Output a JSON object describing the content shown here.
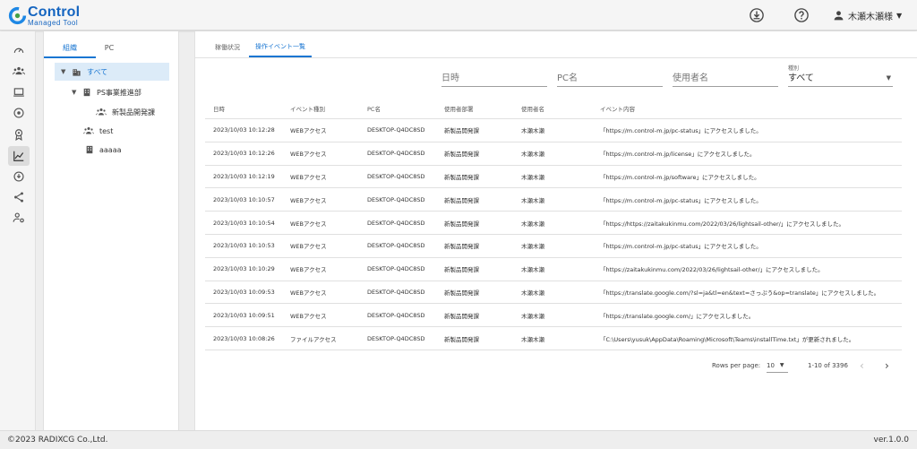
{
  "header": {
    "logo_text": "Control",
    "logo_sub": "Managed Tool",
    "user_name": "木瀬木瀬様",
    "icons": [
      "download-icon",
      "help-icon",
      "account-icon",
      "chevron-down-icon"
    ]
  },
  "rail": {
    "items": [
      {
        "icon": "dashboard-icon",
        "active": false
      },
      {
        "icon": "group-icon",
        "active": false
      },
      {
        "icon": "laptop-icon",
        "active": false
      },
      {
        "icon": "disc-icon",
        "active": false
      },
      {
        "icon": "badge-icon",
        "active": false
      },
      {
        "icon": "chart-icon",
        "active": true
      },
      {
        "icon": "update-icon",
        "active": false
      },
      {
        "icon": "share-icon",
        "active": false
      },
      {
        "icon": "user-settings-icon",
        "active": false
      }
    ]
  },
  "tree": {
    "tabs": [
      "組織",
      "PC"
    ],
    "nodes": [
      {
        "label": "すべて",
        "icon": "building-icon",
        "expanded": true,
        "selected": true
      },
      {
        "label": "PS事業推進部",
        "icon": "building-icon",
        "expanded": true,
        "selected": false
      },
      {
        "label": "新製品開発課",
        "icon": "people-icon",
        "selected": false
      },
      {
        "label": "test",
        "icon": "people-icon",
        "selected": false
      },
      {
        "label": "aaaaa",
        "icon": "building-icon",
        "selected": false
      }
    ]
  },
  "main": {
    "tabs": [
      "稼働状況",
      "操作イベント一覧"
    ],
    "filters": {
      "datetime_placeholder": "日時",
      "pc_placeholder": "PC名",
      "user_placeholder": "使用者名",
      "type_label": "種別",
      "type_value": "すべて"
    },
    "columns": [
      "日時",
      "イベント種別",
      "PC名",
      "使用者部署",
      "使用者名",
      "イベント内容"
    ],
    "rows": [
      [
        "2023/10/03 10:12:28",
        "WEBアクセス",
        "DESKTOP-Q4DC8SD",
        "新製品開発課",
        "木瀬木瀬",
        "「https://m.control-m.jp/pc-status」にアクセスしました。"
      ],
      [
        "2023/10/03 10:12:26",
        "WEBアクセス",
        "DESKTOP-Q4DC8SD",
        "新製品開発課",
        "木瀬木瀬",
        "「https://m.control-m.jp/license」にアクセスしました。"
      ],
      [
        "2023/10/03 10:12:19",
        "WEBアクセス",
        "DESKTOP-Q4DC8SD",
        "新製品開発課",
        "木瀬木瀬",
        "「https://m.control-m.jp/software」にアクセスしました。"
      ],
      [
        "2023/10/03 10:10:57",
        "WEBアクセス",
        "DESKTOP-Q4DC8SD",
        "新製品開発課",
        "木瀬木瀬",
        "「https://m.control-m.jp/pc-status」にアクセスしました。"
      ],
      [
        "2023/10/03 10:10:54",
        "WEBアクセス",
        "DESKTOP-Q4DC8SD",
        "新製品開発課",
        "木瀬木瀬",
        "「https://https://zaitakukinmu.com/2022/03/26/lightsail-other/」にアクセスしました。"
      ],
      [
        "2023/10/03 10:10:53",
        "WEBアクセス",
        "DESKTOP-Q4DC8SD",
        "新製品開発課",
        "木瀬木瀬",
        "「https://m.control-m.jp/pc-status」にアクセスしました。"
      ],
      [
        "2023/10/03 10:10:29",
        "WEBアクセス",
        "DESKTOP-Q4DC8SD",
        "新製品開発課",
        "木瀬木瀬",
        "「https://zaitakukinmu.com/2022/03/26/lightsail-other/」にアクセスしました。"
      ],
      [
        "2023/10/03 10:09:53",
        "WEBアクセス",
        "DESKTOP-Q4DC8SD",
        "新製品開発課",
        "木瀬木瀬",
        "「https://translate.google.com/?sl=ja&tl=en&text=さっぷう&op=translate」にアクセスしました。"
      ],
      [
        "2023/10/03 10:09:51",
        "WEBアクセス",
        "DESKTOP-Q4DC8SD",
        "新製品開発課",
        "木瀬木瀬",
        "「https://translate.google.com/」にアクセスしました。"
      ],
      [
        "2023/10/03 10:08:26",
        "ファイルアクセス",
        "DESKTOP-Q4DC8SD",
        "新製品開発課",
        "木瀬木瀬",
        "「C:\\Users\\yusuk\\AppData\\Roaming\\Microsoft\\Teams\\installTime.txt」が更新されました。"
      ]
    ],
    "pagination": {
      "rows_per_page_label": "Rows per page:",
      "rows_per_page_value": "10",
      "range": "1-10 of 3396"
    }
  },
  "footer": {
    "copyright": "©2023 RADIXCG Co.,Ltd.",
    "version": "ver.1.0.0"
  },
  "colors": {
    "accent": "#1976d2",
    "selected_bg": "#dcebf8",
    "header_bg": "#f5f5f5"
  }
}
